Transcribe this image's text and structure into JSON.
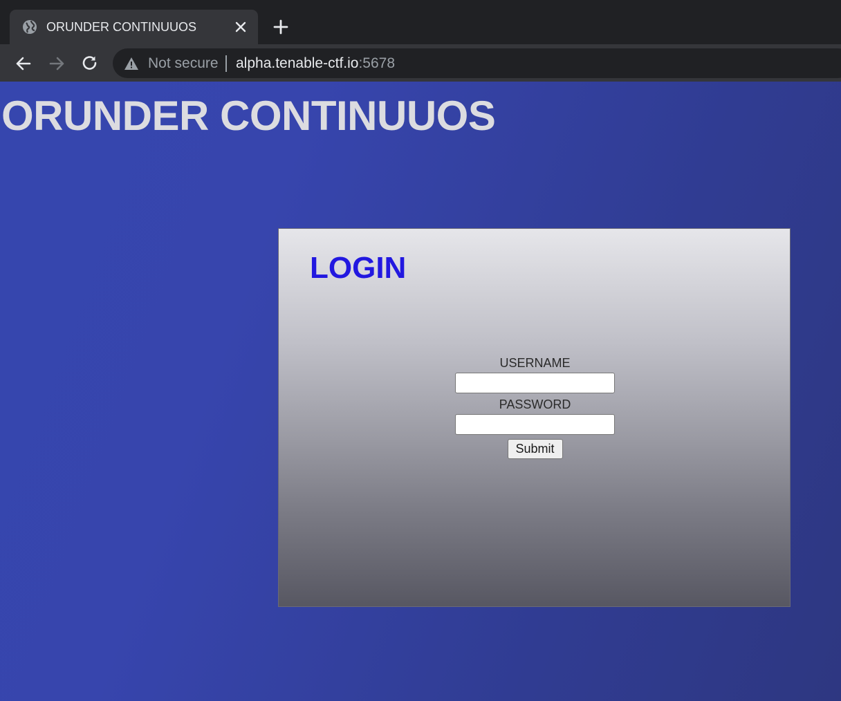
{
  "browser": {
    "tab": {
      "title": "ORUNDER CONTINUUOS",
      "favicon": "globe-icon",
      "close_icon": "close-icon"
    },
    "new_tab_icon": "plus-icon",
    "nav": {
      "back_icon": "back-arrow-icon",
      "forward_icon": "forward-arrow-icon",
      "reload_icon": "reload-icon"
    },
    "omnibox": {
      "security_icon": "warning-icon",
      "security_label": "Not secure",
      "url_host": "alpha.tenable-ctf.io",
      "url_port": ":5678"
    }
  },
  "page": {
    "site_title": "ORUNDER CONTINUUOS",
    "login": {
      "heading": "LOGIN",
      "username_label": "USERNAME",
      "username_value": "",
      "password_label": "PASSWORD",
      "password_value": "",
      "submit_label": "Submit"
    }
  },
  "colors": {
    "page_background": "#3745ad",
    "title_text": "#dcdce0",
    "login_heading": "#2218e0",
    "browser_frame": "#202124",
    "toolbar": "#35363a"
  }
}
